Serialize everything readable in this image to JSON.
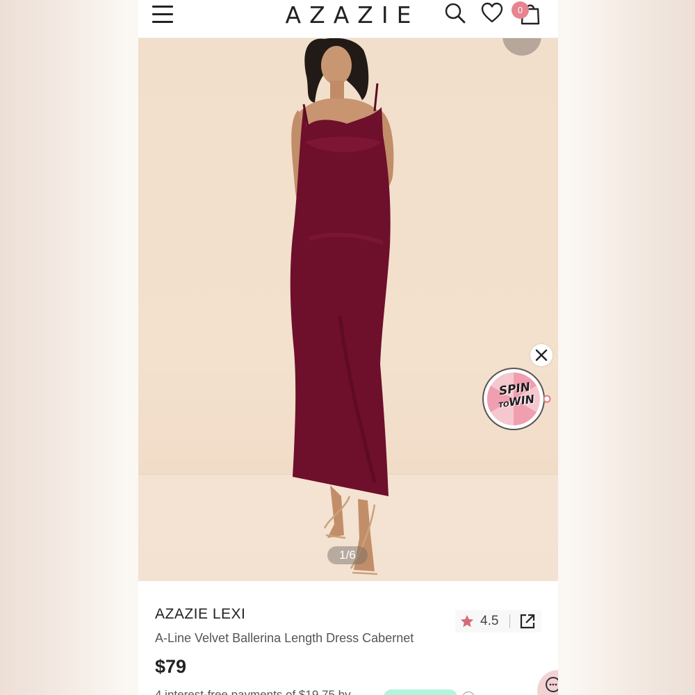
{
  "header": {
    "brand": "AZAZIE",
    "cart_count": "0"
  },
  "gallery": {
    "counter": "1/6"
  },
  "promo": {
    "spin_line1": "SPIN",
    "spin_to": "TO",
    "spin_line2": "WIN"
  },
  "product": {
    "brand_name": "AZAZIE LEXI",
    "title": "A-Line Velvet Ballerina Length Dress Cabernet",
    "price": "$79",
    "rating": "4.5",
    "installment_text": "4 interest-free payments of $19.75 by"
  },
  "colors": {
    "dress": "#6e0f2c",
    "accent_pink": "#e6848f",
    "star": "#d86a78",
    "afterpay_mint": "#b2f5dd"
  },
  "icons": [
    "menu-icon",
    "search-icon",
    "heart-icon",
    "bag-icon",
    "close-icon",
    "star-icon",
    "share-icon",
    "chat-icon"
  ]
}
